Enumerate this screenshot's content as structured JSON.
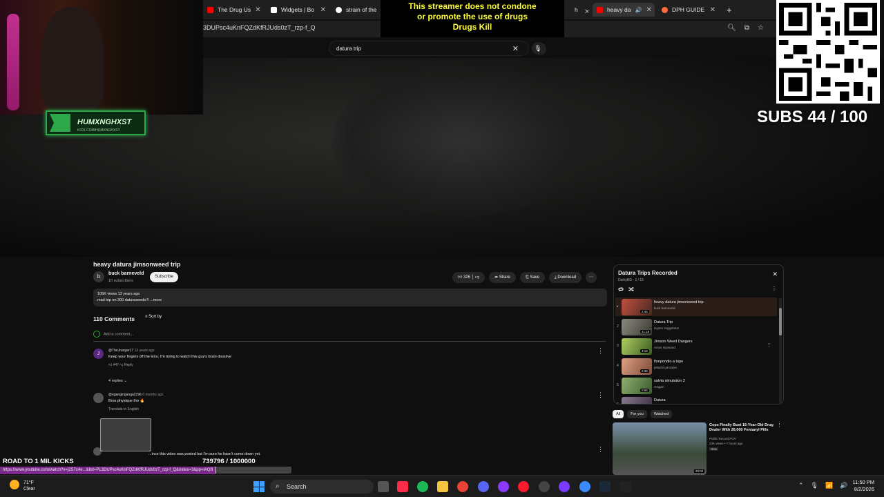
{
  "browser": {
    "tabs": [
      {
        "label": "The Drug Us",
        "color": "#ff0000",
        "active": false
      },
      {
        "label": "Widgets | Bo",
        "color": "#ffffff",
        "active": false
      },
      {
        "label": "strain of the",
        "color": "#ffffff",
        "active": false
      },
      {
        "label": "heavy da",
        "color": "#ff0000",
        "active": true
      },
      {
        "label": "DPH GUIDE",
        "color": "#ff6b3a",
        "active": false
      }
    ],
    "url": "3DUPsc4uKnFQZdKfRJUds0zT_rzp-f_Q"
  },
  "search": {
    "query": "datura trip"
  },
  "overlay": {
    "disclaimer_line1": "This streamer does not condone",
    "disclaimer_line2": "or promote the use of drugs",
    "disclaimer_line3": "Drugs Kill",
    "badge_name": "HUMXNGHXST",
    "badge_sub": "KICK.COM/HUMXNGHXST",
    "subs_goal": "SUBS 44 / 100",
    "road_label": "ROAD TO 1 MIL KICKS",
    "kicks_count": "739796 / 1000000",
    "kicks_progress": 0.74,
    "status_url": "https://www.youtube.com/watch?v=j2S7c4e...&list=PL3DUPsc4uKnFQZdKfRJUds0zT_rzp-f_Q&index=3&pp=iAQB"
  },
  "video": {
    "title": "heavy datura jimsonweed trip",
    "channel": "buck barneveld",
    "channel_initial": "b",
    "subscribers": "10 subscribers",
    "subscribe_label": "Subscribe",
    "likes": "326",
    "share_label": "Share",
    "save_label": "Save",
    "download_label": "Download",
    "views_line": "105K views  13 years ago",
    "description": "mad trip on 300 daturaseeds!!!  ...more"
  },
  "comments": {
    "header": "110 Comments",
    "sort_label": "Sort by",
    "add_placeholder": "Add a comment...",
    "items": [
      {
        "initial": "J",
        "author": "@TheJranger17",
        "time": "13 years ago",
        "text": "Keep your fingers off the lens, I'm trying to watch this guy's brain dissolve",
        "likes": "447",
        "reply": "Reply",
        "color": "#5a2a80"
      },
      {
        "initial": "",
        "author": "@eganginganga2296",
        "time": "6 months ago",
        "text": "Bros physique tho 🔥",
        "likes": "",
        "reply": "Translate to English",
        "color": "#555555"
      },
      {
        "initial": "",
        "author": "",
        "time": "",
        "text": "...ince this video was posted but I'm sure he hasn't come down yet.",
        "likes": "",
        "reply": "",
        "color": "#555555"
      }
    ],
    "replies_label": "4 replies"
  },
  "playlist": {
    "title": "Datura Trips Recorded",
    "subtitle": "DarkyBD - 1 / 15",
    "items": [
      {
        "index": "",
        "name": "heavy datura jimsonweed trip",
        "author": "buck barneveld",
        "duration": "2:45"
      },
      {
        "index": "2",
        "name": "Datura Trip",
        "author": "Hypno Juggalotus",
        "duration": "41:19"
      },
      {
        "index": "3",
        "name": "Jimson Weed Dangers",
        "author": "Amos Norwood",
        "duration": "4:16"
      },
      {
        "index": "4",
        "name": "floripondio a tope",
        "author": "pitlashi gonzales",
        "duration": "2:36"
      },
      {
        "index": "5",
        "name": "salvia simulation 2",
        "author": "Grigpin",
        "duration": "0:55"
      },
      {
        "index": "6",
        "name": "Datura",
        "author": "",
        "duration": ""
      }
    ]
  },
  "chips": [
    "All",
    "For you",
    "Watched"
  ],
  "recommended": {
    "title": "Cops Finally Bust 16-Year-Old Drug Dealer With 26,000 Fentanyl Pills",
    "channel": "Public Record POV",
    "views": "23K views • 7 hours ago",
    "badge": "New",
    "duration": "20:02"
  },
  "taskbar": {
    "temperature": "71°F",
    "condition": "Clear",
    "search_label": "Search",
    "time": "11:50 PM",
    "date": "8/2/2026"
  }
}
